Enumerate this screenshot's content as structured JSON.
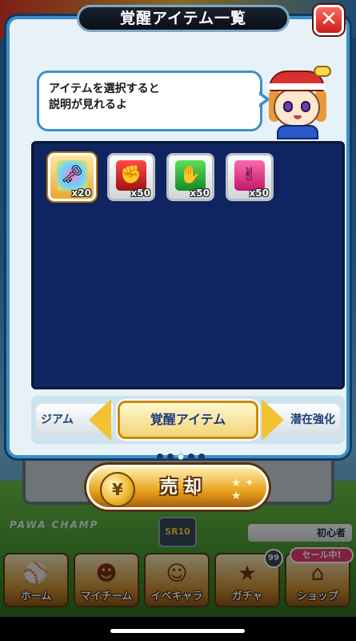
{
  "modal": {
    "title": "覚醒アイテム一覧",
    "close_label": "✕"
  },
  "speech_bubble": {
    "text_line1": "アイテムを選択すると",
    "text_line2": "説明が見れるよ"
  },
  "items": [
    {
      "icon": "rainbow-key-icon",
      "glyph": "🗝",
      "count": "x20",
      "selected": true
    },
    {
      "icon": "red-card-icon",
      "glyph": "✊",
      "count": "x50",
      "selected": false
    },
    {
      "icon": "green-card-icon",
      "glyph": "✋",
      "count": "x50",
      "selected": false
    },
    {
      "icon": "pink-card-icon",
      "glyph": "✌",
      "count": "x50",
      "selected": false
    }
  ],
  "category_tabs": {
    "prev": "ジアム",
    "current": "覚醒アイテム",
    "next": "潜在強化"
  },
  "page_indicator": {
    "total": 5,
    "active": 2
  },
  "sell_button": {
    "label": "売 却"
  },
  "background": {
    "sr_badge": "SR10",
    "rank_label": "初心者",
    "logo_text": "PAWA CHAMP",
    "sale_badge": "セール中!",
    "count_badge": "99"
  },
  "bottom_nav": [
    {
      "label": "ホーム",
      "icon": "home-icon"
    },
    {
      "label": "マイチーム",
      "icon": "team-icon"
    },
    {
      "label": "イベキャラ",
      "icon": "event-character-icon"
    },
    {
      "label": "ガチャ",
      "icon": "gacha-icon"
    },
    {
      "label": "ショップ",
      "icon": "shop-icon"
    }
  ],
  "colors": {
    "modal_border": "#3d8fc7",
    "panel_bg": "#0f2460",
    "accent_gold": "#f2c232",
    "close_red": "#c81d1d"
  }
}
